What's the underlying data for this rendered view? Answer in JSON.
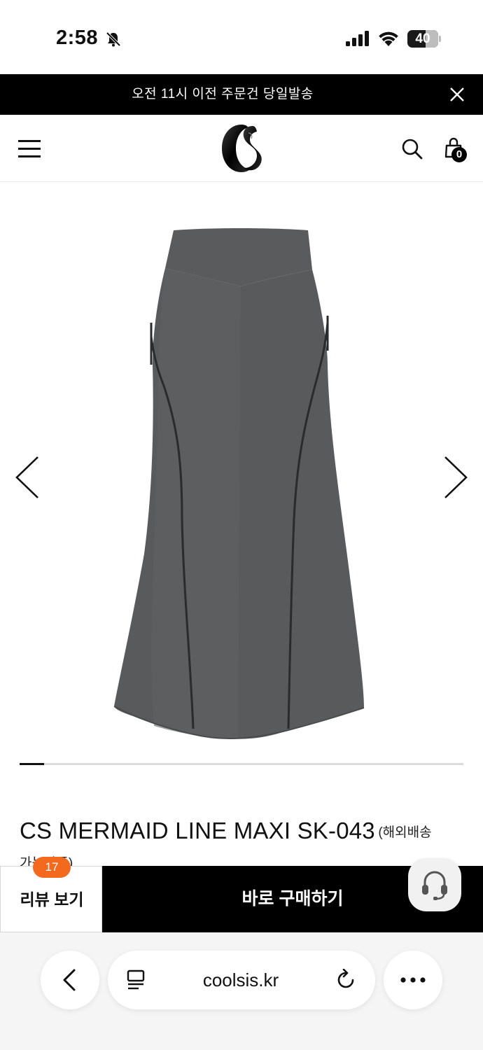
{
  "status_bar": {
    "time": "2:58",
    "battery_level": "40",
    "icons": [
      "bell-slash-icon",
      "cellular-signal-icon",
      "wifi-icon",
      "battery-icon"
    ]
  },
  "announcement": {
    "text": "오전 11시 이전 주문건 당일발송",
    "close_icon": "close-icon"
  },
  "header": {
    "menu_icon": "hamburger-menu-icon",
    "logo": "CS logo",
    "search_icon": "search-icon",
    "cart_icon": "shopping-bag-icon",
    "cart_count": "0"
  },
  "gallery": {
    "image": "dark gray mermaid maxi skirt",
    "prev_icon": "chevron-left-icon",
    "next_icon": "chevron-right-icon",
    "progress_fraction": 0.055
  },
  "product": {
    "name": "CS MERMAID LINE MAXI SK-043",
    "note_line1": "(해외배송",
    "note_line2": "가능상품)"
  },
  "actions": {
    "review_label": "리뷰 보기",
    "review_count": "17",
    "buy_label": "바로 구매하기",
    "support_icon": "headset-icon"
  },
  "browser": {
    "back_icon": "chevron-left-icon",
    "reader_icon": "reader-mode-icon",
    "url": "coolsis.kr",
    "reload_icon": "reload-icon",
    "more_icon": "more-dots-icon"
  },
  "colors": {
    "accent_badge": "#f36a1e",
    "primary_button": "#000000",
    "skirt": "#545658"
  }
}
